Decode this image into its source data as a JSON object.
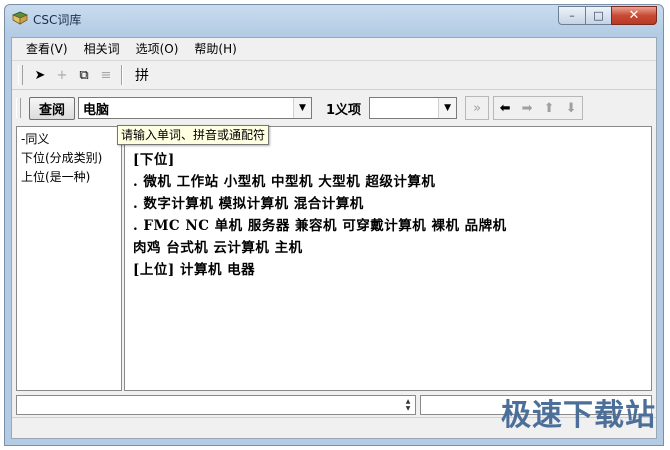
{
  "window": {
    "title": "CSC词库",
    "minimize": "–",
    "maximize": "□",
    "close": "✕"
  },
  "menu": [
    "查看(V)",
    "相关词",
    "选项(O)",
    "帮助(H)"
  ],
  "toolbar": {
    "pointer": "➤",
    "add": "+",
    "copy": "⧉",
    "list": "≡",
    "pinyin": "拼"
  },
  "search": {
    "button": "查阅",
    "value": "电脑",
    "sense_label": "1义项",
    "sense_value": "",
    "tooltip": "请输入单词、拼音或通配符"
  },
  "nav": {
    "expand": "»",
    "back": "⬅",
    "forward": "➡",
    "up": "⬆",
    "down": "⬇"
  },
  "tree": [
    "-同义",
    "下位(分成类别)",
    "上位(是一种)"
  ],
  "content": [
    "[下位]",
    ". 微机  工作站  小型机  中型机  大型机  超级计算机",
    ". 数字计算机  模拟计算机  混合计算机",
    ". FMC  NC  单机  服务器  兼容机  可穿戴计算机  裸机  品牌机",
    "肉鸡  台式机  云计算机  主机",
    "[上位]  计算机  电器"
  ],
  "watermark": "极速下载站"
}
